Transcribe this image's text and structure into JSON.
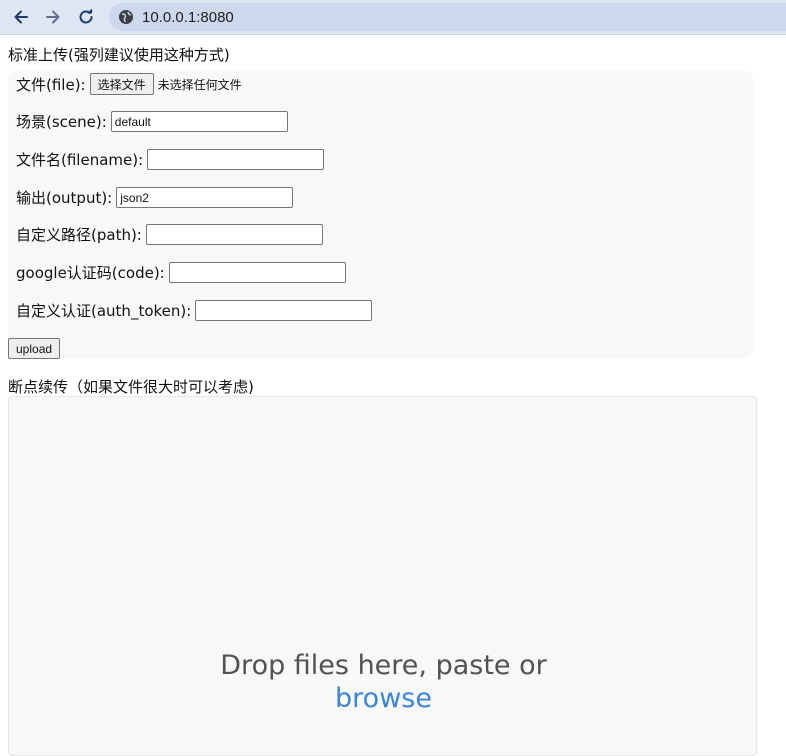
{
  "browser": {
    "url": "10.0.0.1:8080",
    "icons": {
      "back": "arrow-left-icon",
      "forward": "arrow-right-icon",
      "reload": "reload-icon",
      "site": "site-info-icon"
    }
  },
  "standard_upload": {
    "title": "标准上传(强列建议使用这种方式)",
    "file_label": "文件(file):",
    "file_button": "选择文件",
    "file_status": "未选择任何文件",
    "scene_label": "场景(scene):",
    "scene_value": "default",
    "filename_label": "文件名(filename):",
    "filename_value": "",
    "output_label": "输出(output):",
    "output_value": "json2",
    "path_label": "自定义路径(path):",
    "path_value": "",
    "code_label": "google认证码(code):",
    "code_value": "",
    "token_label": "自定义认证(auth_token):",
    "token_value": "",
    "upload_button": "upload"
  },
  "resumable_upload": {
    "title": "断点续传（如果文件很大时可以考虑)",
    "drop_text": "Drop files here, paste or",
    "browse_text": "browse"
  },
  "colors": {
    "browse_link": "#3b86d9",
    "chrome_bg": "#dfe6f3"
  }
}
